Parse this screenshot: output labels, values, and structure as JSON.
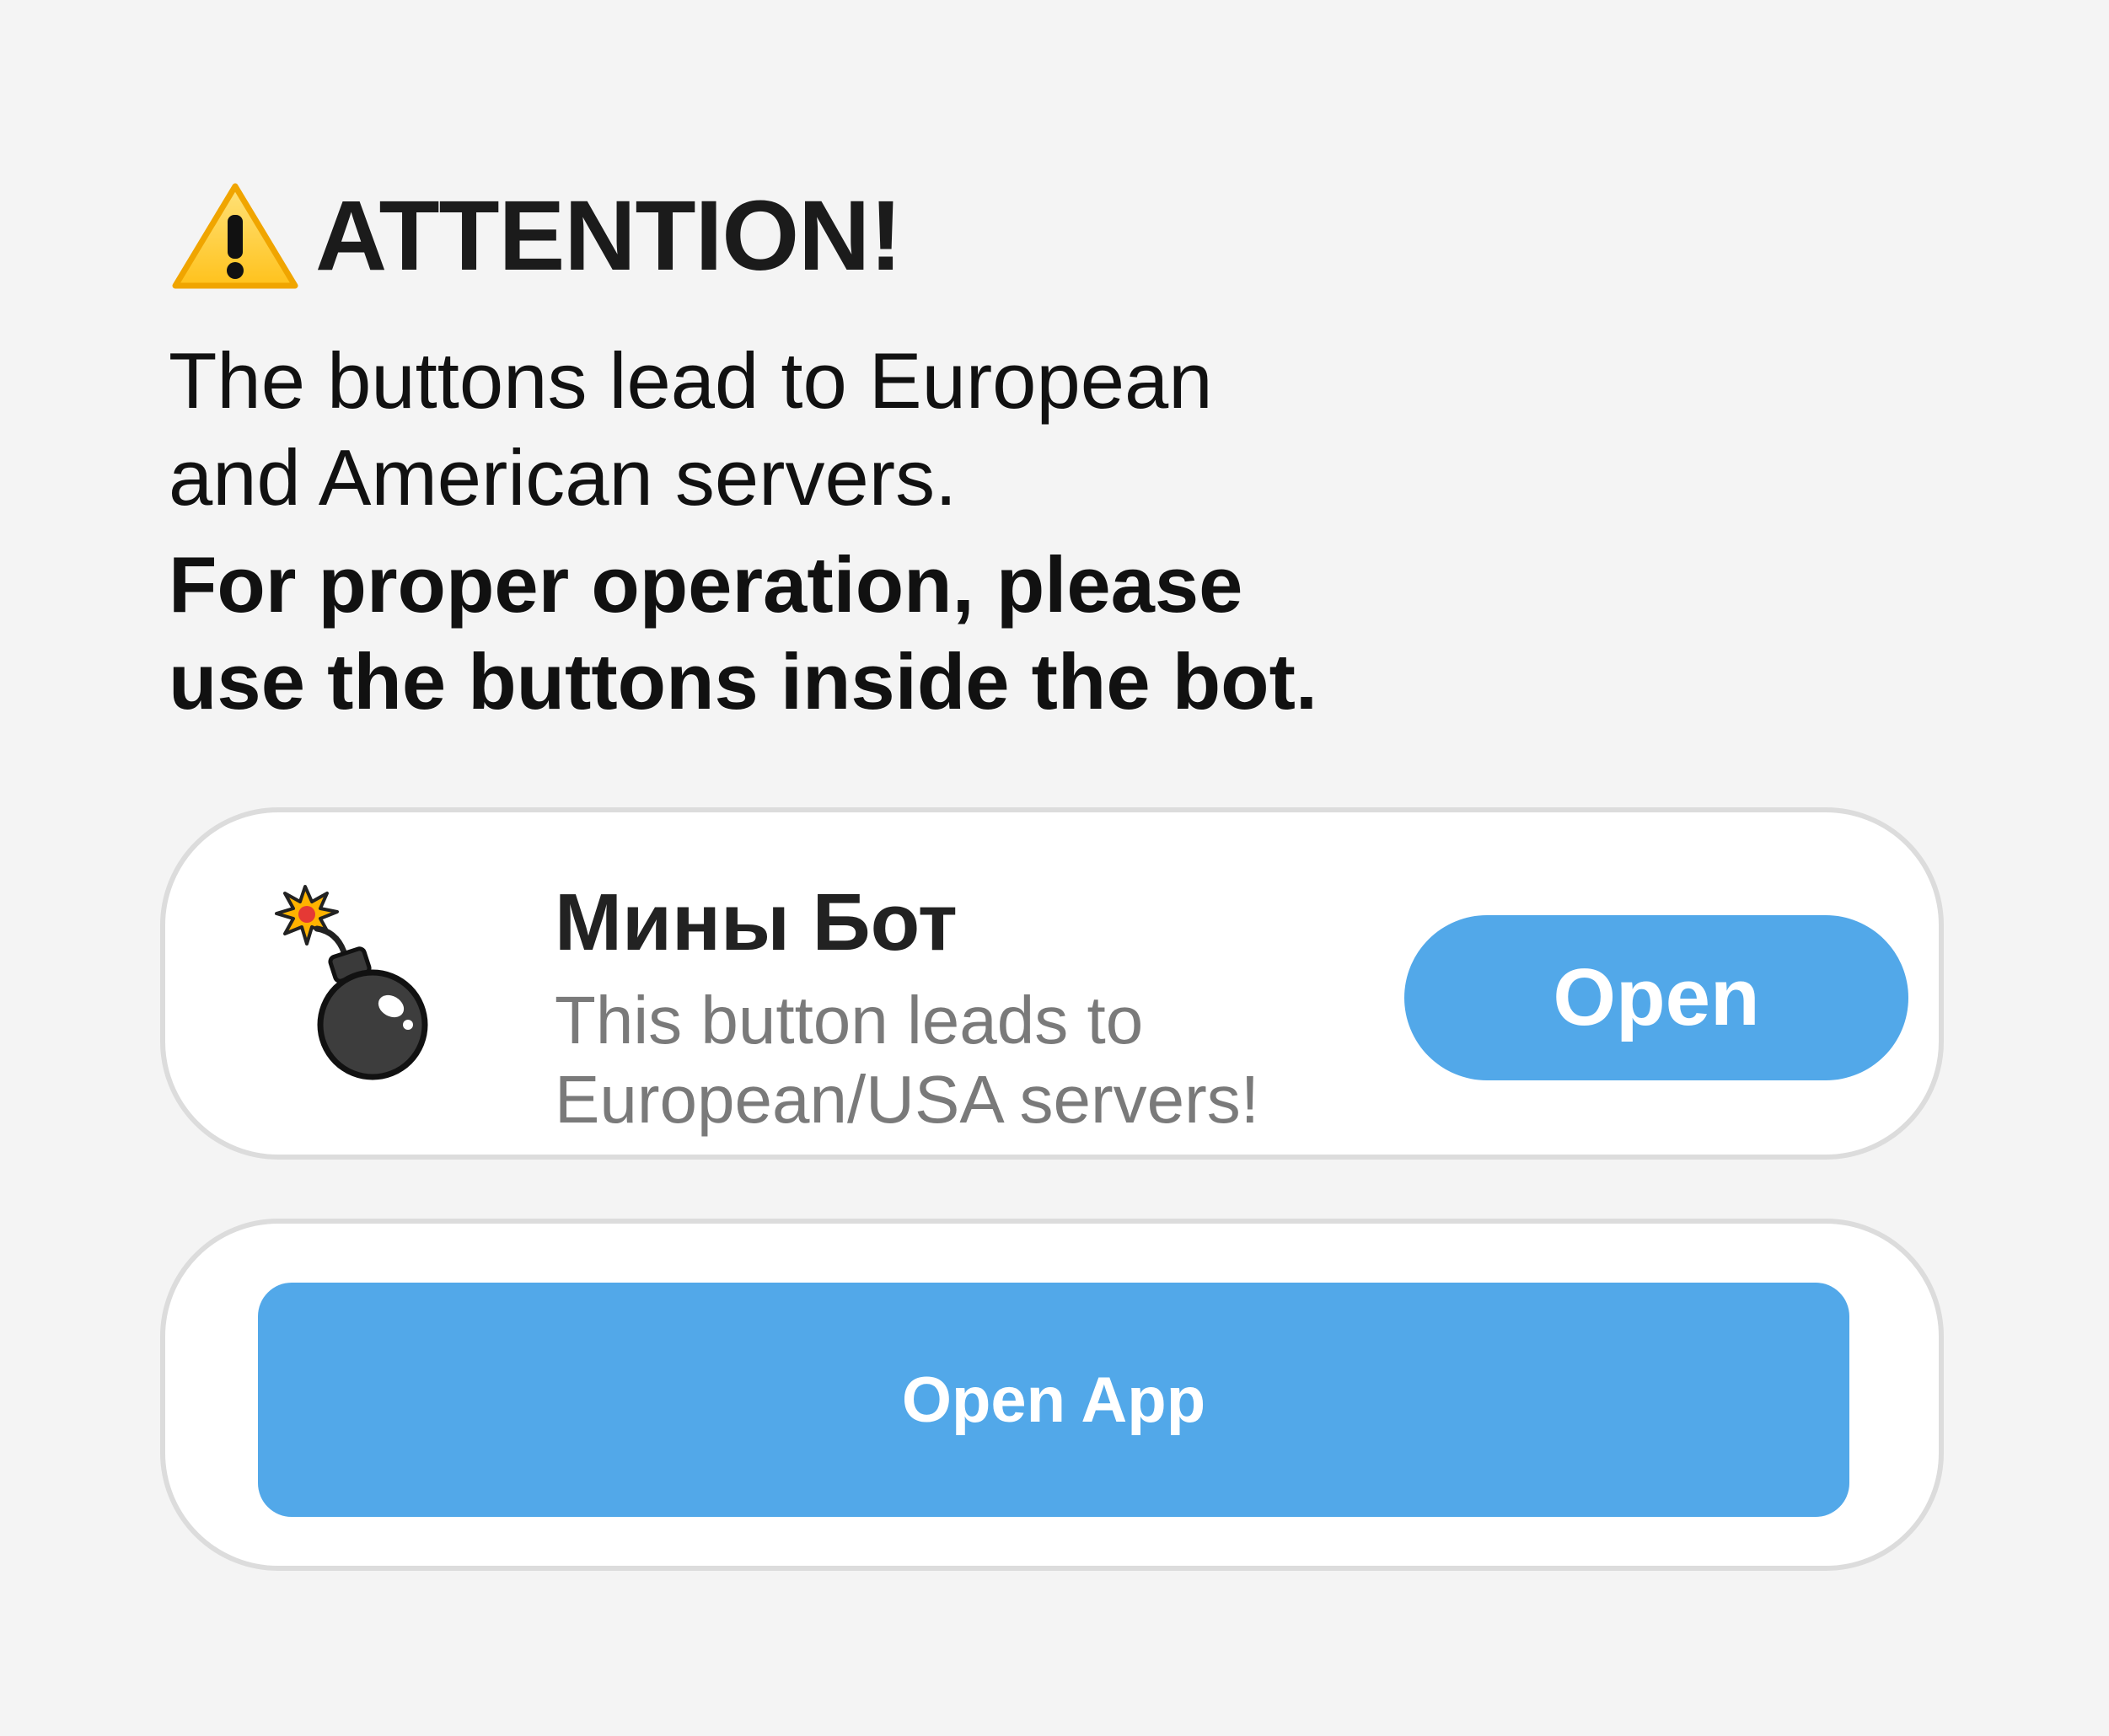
{
  "notice": {
    "icon": "warning-icon",
    "title": "ATTENTION!",
    "text_lines": [
      "The buttons lead to European",
      "and American servers."
    ],
    "strong_lines": [
      "For proper operation, please",
      "use the buttons inside the bot."
    ]
  },
  "bot_card": {
    "icon": "bomb-icon",
    "name": "Мины Бот",
    "description_lines": [
      "This button leads to",
      "European/USA servers!"
    ],
    "open_label": "Open"
  },
  "app_card": {
    "open_app_label": "Open App"
  },
  "colors": {
    "background": "#f4f4f4",
    "card": "#ffffff",
    "card_border": "#dcdcdc",
    "accent": "#52a8e9",
    "warning_yellow": "#ffcc33"
  }
}
